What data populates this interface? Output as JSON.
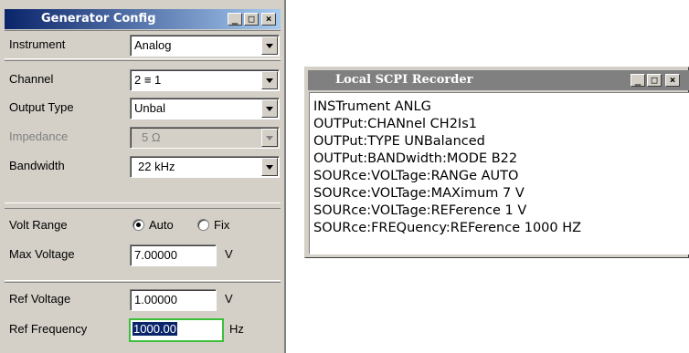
{
  "generator_config": {
    "title": "Generator Config",
    "rows": {
      "instrument": {
        "label": "Instrument",
        "value": "Analog"
      },
      "channel": {
        "label": "Channel",
        "value": "2 ≡ 1"
      },
      "output_type": {
        "label": "Output Type",
        "value": "Unbal"
      },
      "impedance": {
        "label": "Impedance",
        "value": "5 Ω",
        "disabled": true
      },
      "bandwidth": {
        "label": "Bandwidth",
        "value": "22 kHz"
      },
      "volt_range": {
        "label": "Volt Range",
        "options": [
          "Auto",
          "Fix"
        ],
        "selected": "Auto"
      },
      "max_voltage": {
        "label": "Max Voltage",
        "value": "7.00000",
        "unit": "V"
      },
      "ref_voltage": {
        "label": "Ref Voltage",
        "value": "1.00000",
        "unit": "V"
      },
      "ref_frequency": {
        "label": "Ref Frequency",
        "value": "1000.00",
        "unit": "Hz"
      }
    }
  },
  "scpi_recorder": {
    "title": "Local SCPI Recorder",
    "lines": [
      "INSTrument ANLG",
      "OUTPut:CHANnel CH2Is1",
      "OUTPut:TYPE UNBalanced",
      "OUTPut:BANDwidth:MODE B22",
      "SOURce:VOLTage:RANGe AUTO",
      "SOURce:VOLTage:MAXimum 7 V",
      "SOURce:VOLTage:REFerence 1 V",
      "SOURce:FREQuency:REFerence 1000 HZ"
    ]
  },
  "window_buttons": {
    "minimize": "_",
    "maximize": "□",
    "close": "×"
  },
  "colors": {
    "active_title_start": "#0a246a",
    "active_title_end": "#a6caf0",
    "inactive_title": "#808080",
    "focus_border": "#3cc03c",
    "selection": "#0a246a"
  }
}
